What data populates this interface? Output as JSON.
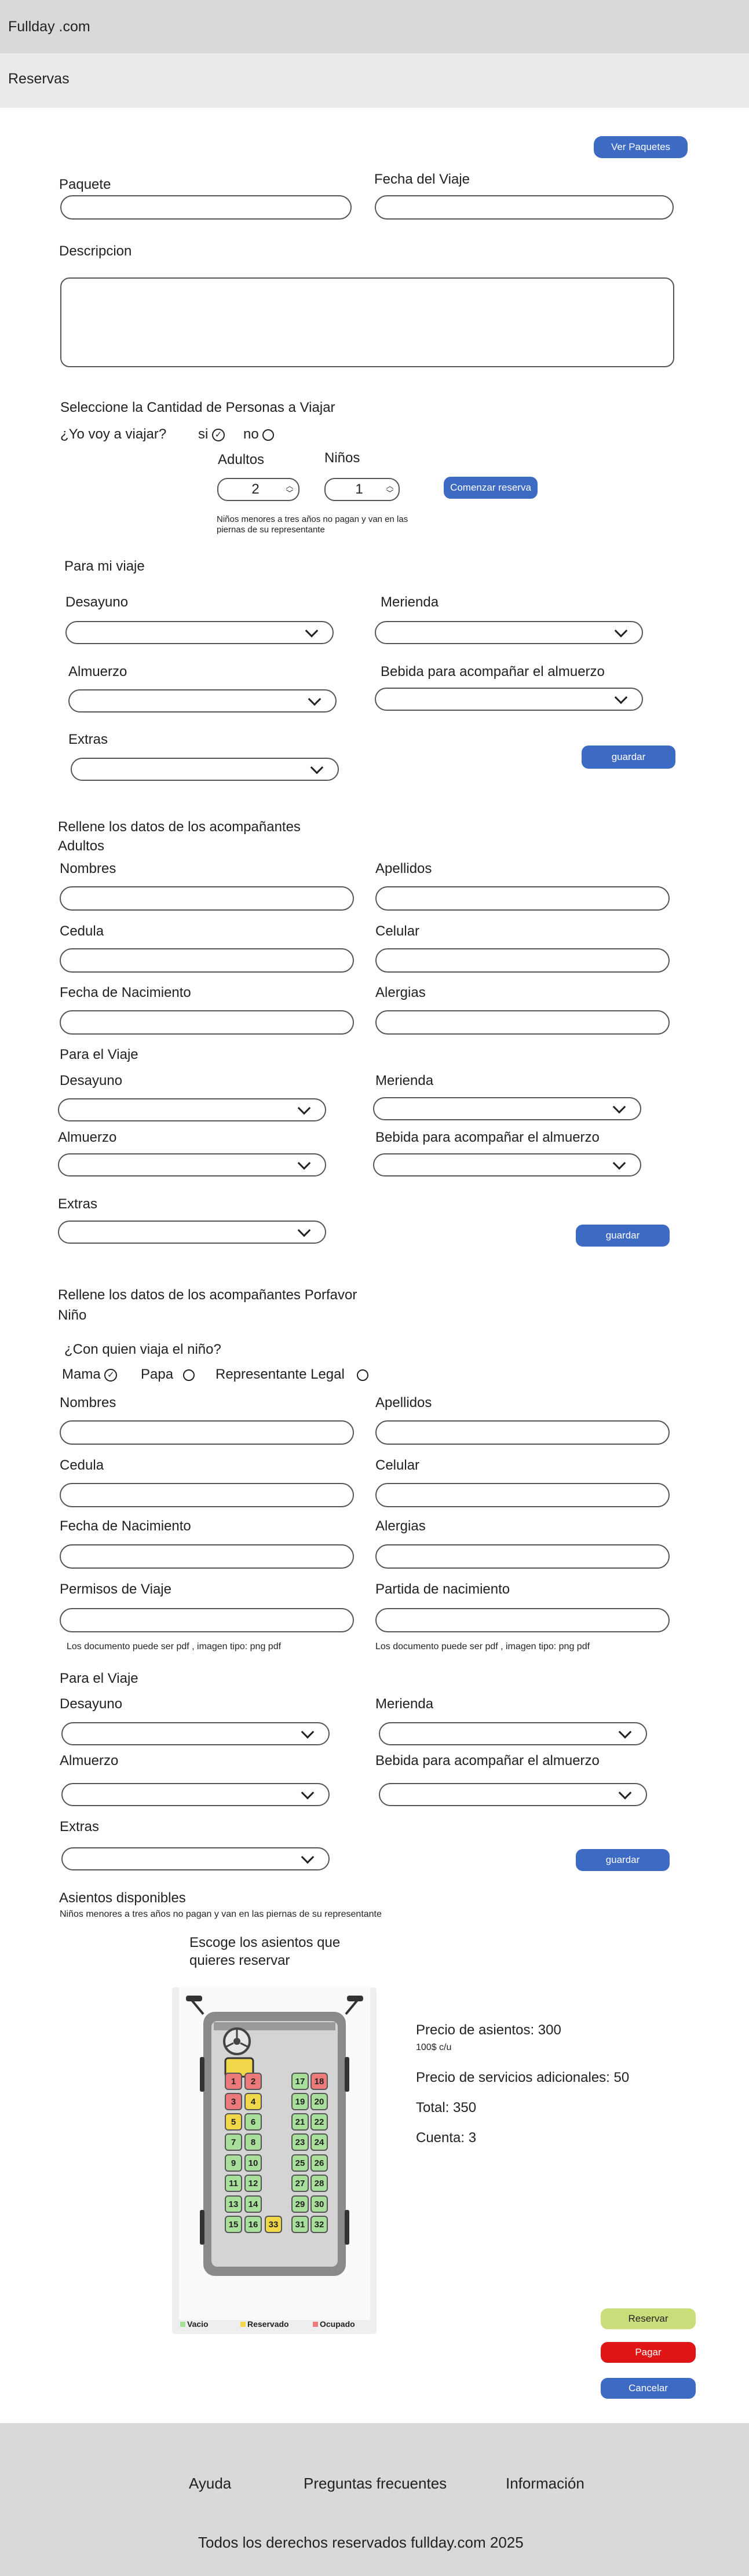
{
  "header": {
    "brand": "Fullday .com",
    "subtitle": "Reservas"
  },
  "package": {
    "view_packages_label": "Ver Paquetes",
    "package_label": "Paquete",
    "date_label": "Fecha del Viaje",
    "description_label": "Descripcion"
  },
  "people": {
    "title": "Seleccione la Cantidad de Personas a Viajar",
    "question": "¿Yo voy a viajar?",
    "yes": "si",
    "no": "no",
    "adults_label": "Adultos",
    "children_label": "Niños",
    "adults_value": "2",
    "children_value": "1",
    "start_label": "Comenzar reserva",
    "note": "Niños menores a tres años no pagan y van en las piernas de su representante"
  },
  "my_trip": {
    "title": "Para mi viaje",
    "breakfast": "Desayuno",
    "snack": "Merienda",
    "lunch": "Almuerzo",
    "drink": "Bebida para acompañar el almuerzo",
    "extras": "Extras",
    "save": "guardar"
  },
  "adults": {
    "title": "Rellene los datos de los acompañantes",
    "subtitle": "Adultos",
    "names": "Nombres",
    "surnames": "Apellidos",
    "id": "Cedula",
    "phone": "Celular",
    "birth": "Fecha de Nacimiento",
    "allergies": "Alergias",
    "trip_title": "Para el Viaje",
    "breakfast": "Desayuno",
    "snack": "Merienda",
    "lunch": "Almuerzo",
    "drink": "Bebida para acompañar el almuerzo",
    "extras": "Extras",
    "save": "guardar"
  },
  "child": {
    "title": "Rellene los datos de los acompañantes Porfavor",
    "subtitle": "Niño",
    "question": "¿Con quien viaja el niño?",
    "mom": "Mama",
    "dad": "Papa",
    "guardian": "Representante Legal",
    "names": "Nombres",
    "surnames": "Apellidos",
    "id": "Cedula",
    "phone": "Celular",
    "birth": "Fecha de Nacimiento",
    "allergies": "Alergias",
    "permits": "Permisos de Viaje",
    "birth_cert": "Partida de nacimiento",
    "doc_note": "Los documento puede ser pdf , imagen tipo: png pdf",
    "trip_title": "Para el Viaje",
    "breakfast": "Desayuno",
    "snack": "Merienda",
    "lunch": "Almuerzo",
    "drink": "Bebida para acompañar el almuerzo",
    "extras": "Extras",
    "save": "guardar"
  },
  "seats": {
    "title": "Asientos disponibles",
    "note": "Niños menores a tres años no pagan y van en las piernas de su representante",
    "choose_line1": "Escoge los asientos que",
    "choose_line2": "quieres reservar",
    "legend_free": "Vacio",
    "legend_reserved": "Reservado",
    "legend_occupied": "Ocupado",
    "colors": {
      "free": "#a8df9b",
      "reserved": "#f1d74a",
      "occupied": "#ec7a7a"
    },
    "occupied": [
      "1",
      "2",
      "3",
      "18"
    ],
    "reserved": [
      "4",
      "5",
      "33"
    ],
    "seat_labels": [
      "1",
      "2",
      "3",
      "4",
      "5",
      "6",
      "7",
      "8",
      "9",
      "10",
      "11",
      "12",
      "13",
      "14",
      "15",
      "16",
      "17",
      "18",
      "19",
      "20",
      "21",
      "22",
      "23",
      "24",
      "25",
      "26",
      "27",
      "28",
      "29",
      "30",
      "31",
      "32",
      "33"
    ]
  },
  "summary": {
    "seat_price": "Precio de asientos: 300",
    "seat_unit": "100$ c/u",
    "extra_price": "Precio de servicios adicionales: 50",
    "total": "Total: 350",
    "count": "Cuenta: 3"
  },
  "actions": {
    "reserve": "Reservar",
    "pay": "Pagar",
    "cancel": "Cancelar"
  },
  "footer": {
    "help": "Ayuda",
    "faq": "Preguntas frecuentes",
    "info": "Información",
    "copyright": "Todos los derechos reservados fullday.com 2025"
  }
}
